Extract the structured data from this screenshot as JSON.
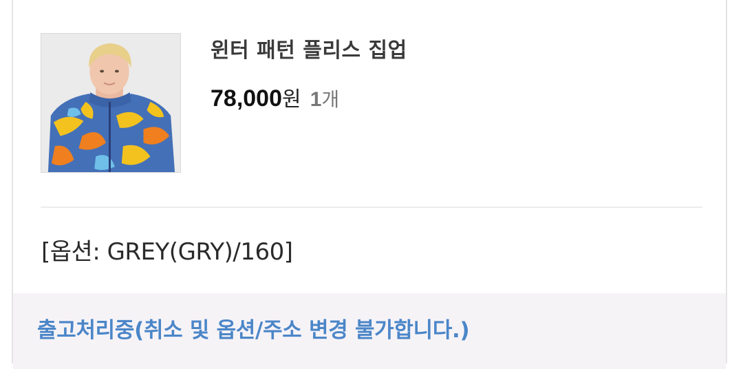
{
  "product": {
    "name": "윈터 패턴 플리스 집업",
    "price": "78,000",
    "price_unit": "원",
    "quantity": "1",
    "quantity_unit": "개",
    "option_text": "[옵션: GREY(GRY)/160]",
    "image_icon": "product-photo-camo-fleece-jacket"
  },
  "status": {
    "text": "출고처리중(취소 및 옵션/주소 변경 불가합니다.)",
    "color": "#4b86c8"
  }
}
